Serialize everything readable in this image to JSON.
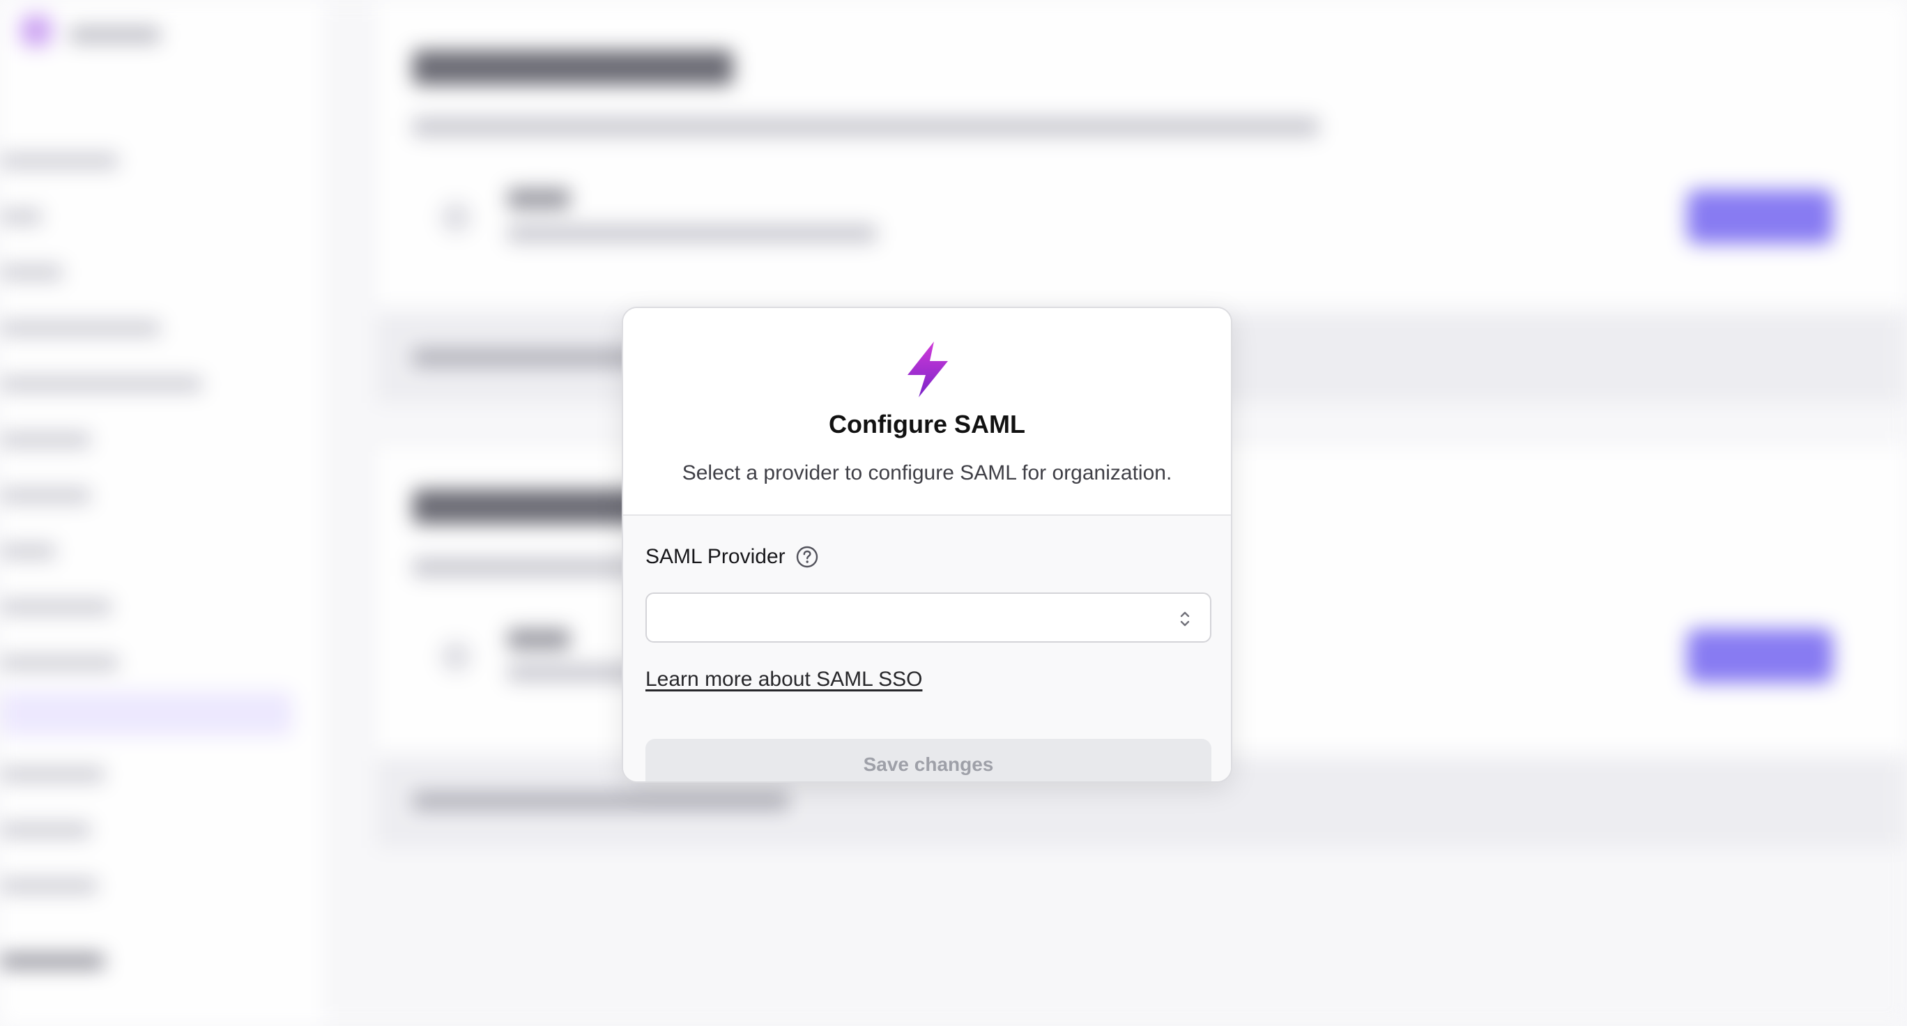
{
  "modal": {
    "icon": "lightning-bolt-icon",
    "title": "Configure SAML",
    "subtitle": "Select a provider to configure SAML for organization.",
    "provider_field": {
      "label": "SAML Provider",
      "help_icon": "question-circle-icon",
      "value": "",
      "chevron_icon": "chevron-up-down-icon"
    },
    "learn_more_link": "Learn more about SAML SSO",
    "save_button": {
      "label": "Save changes",
      "disabled": true
    }
  },
  "colors": {
    "bolt_gradient_start": "#c026d3",
    "bolt_gradient_end": "#7e22ce",
    "background_accent": "#7c6ef2"
  }
}
